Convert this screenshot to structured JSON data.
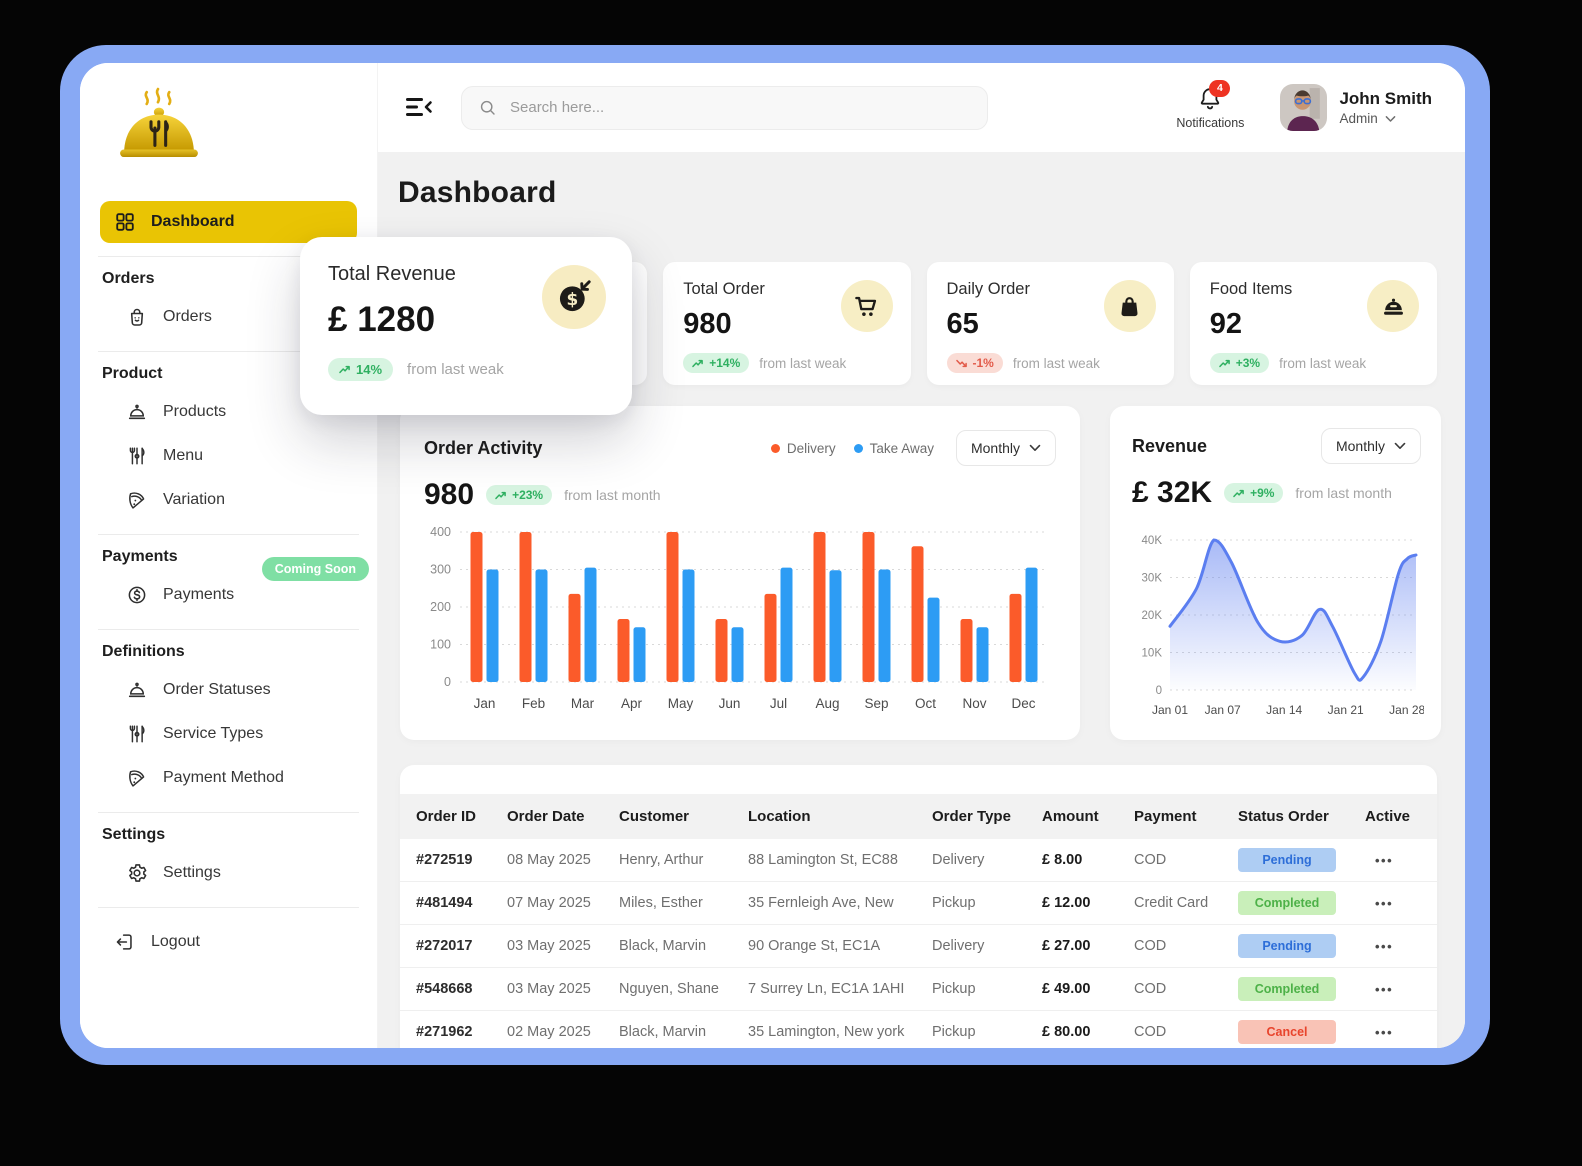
{
  "page": {
    "title": "Dashboard"
  },
  "topbar": {
    "search_placeholder": "Search here...",
    "notifications_label": "Notifications",
    "notifications_count": "4",
    "user_name": "John Smith",
    "user_role": "Admin"
  },
  "sidebar": {
    "sections": [
      {
        "items": [
          {
            "label": "Dashboard",
            "icon": "dashboard",
            "active": true
          }
        ]
      },
      {
        "header": "Orders",
        "items": [
          {
            "label": "Orders",
            "icon": "bag"
          }
        ]
      },
      {
        "header": "Product",
        "items": [
          {
            "label": "Products",
            "icon": "cloche"
          },
          {
            "label": "Menu",
            "icon": "cutlery"
          },
          {
            "label": "Variation",
            "icon": "pizza"
          }
        ]
      },
      {
        "header": "Payments",
        "badge": "Coming Soon",
        "items": [
          {
            "label": "Payments",
            "icon": "dollar"
          }
        ]
      },
      {
        "header": "Definitions",
        "items": [
          {
            "label": "Order Statuses",
            "icon": "cloche"
          },
          {
            "label": "Service Types",
            "icon": "cutlery"
          },
          {
            "label": "Payment Method",
            "icon": "pizza"
          }
        ]
      },
      {
        "header": "Settings",
        "items": [
          {
            "label": "Settings",
            "icon": "gear"
          }
        ]
      },
      {
        "items": [
          {
            "label": "Logout",
            "icon": "logout"
          }
        ]
      }
    ]
  },
  "stats": {
    "floating": {
      "title": "Total Revenue",
      "value": "£ 1280",
      "badge": "14%",
      "badge_dir": "up",
      "note": "from last weak",
      "icon": "money"
    },
    "cards": [
      {
        "title": "Total Order",
        "value": "980",
        "badge": "+14%",
        "badge_dir": "up",
        "note": "from last weak",
        "icon": "cart"
      },
      {
        "title": "Daily Order",
        "value": "65",
        "badge": "-1%",
        "badge_dir": "down",
        "note": "from last weak",
        "icon": "basket"
      },
      {
        "title": "Food Items",
        "value": "92",
        "badge": "+3%",
        "badge_dir": "up",
        "note": "from last weak",
        "icon": "cloche-solid"
      }
    ]
  },
  "order_activity": {
    "title": "Order Activity",
    "value": "980",
    "badge": "+23%",
    "note": "from last month",
    "filter": "Monthly"
  },
  "revenue": {
    "title": "Revenue",
    "value": "£ 32K",
    "badge": "+9%",
    "note": "from last month",
    "filter": "Monthly"
  },
  "chart_data": [
    {
      "id": "order-activity",
      "type": "bar",
      "title": "Order Activity",
      "categories": [
        "Jan",
        "Feb",
        "Mar",
        "Apr",
        "May",
        "Jun",
        "Jul",
        "Aug",
        "Sep",
        "Oct",
        "Nov",
        "Dec"
      ],
      "series": [
        {
          "name": "Delivery",
          "color": "#FB5B2A",
          "values": [
            400,
            400,
            235,
            168,
            400,
            168,
            235,
            400,
            400,
            362,
            168,
            235
          ]
        },
        {
          "name": "Take Away",
          "color": "#2D9CF4",
          "values": [
            300,
            300,
            305,
            146,
            300,
            146,
            305,
            298,
            300,
            225,
            146,
            305
          ]
        }
      ],
      "ylim": [
        0,
        400
      ],
      "yticks": [
        0,
        100,
        200,
        300,
        400
      ],
      "grid": "dotted-horizontal",
      "legend_position": "top-right",
      "xlabel": "",
      "ylabel": ""
    },
    {
      "id": "revenue",
      "type": "area",
      "title": "Revenue (£, January)",
      "x_days": [
        1,
        4,
        6,
        8,
        11,
        13.5,
        16,
        18,
        19.5,
        22,
        23,
        25,
        27,
        28,
        29
      ],
      "values_k": [
        17,
        27,
        40,
        34,
        18,
        13,
        14.5,
        21.5,
        17,
        4.5,
        3.5,
        13,
        31,
        35,
        36
      ],
      "xticks": [
        {
          "day": 1,
          "label": "Jan 01"
        },
        {
          "day": 7,
          "label": "Jan 07"
        },
        {
          "day": 14,
          "label": "Jan 14"
        },
        {
          "day": 21,
          "label": "Jan 21"
        },
        {
          "day": 28,
          "label": "Jan 28"
        }
      ],
      "yticks": [
        {
          "v": 0,
          "label": "0"
        },
        {
          "v": 10,
          "label": "10K"
        },
        {
          "v": 20,
          "label": "20K"
        },
        {
          "v": 30,
          "label": "30K"
        },
        {
          "v": 40,
          "label": "40K"
        }
      ],
      "ylim_k": [
        0,
        40
      ],
      "line_color": "#5B7EF0",
      "fill_from": "rgba(106,136,240,0.58)",
      "fill_to": "rgba(106,136,240,0.02)",
      "grid": "dotted-horizontal"
    }
  ],
  "table": {
    "headers": [
      "Order ID",
      "Order Date",
      "Customer",
      "Location",
      "Order Type",
      "Amount",
      "Payment",
      "Status Order",
      "Active"
    ],
    "actions_glyph": "•••",
    "rows": [
      {
        "id": "#272519",
        "date": "08 May 2025",
        "customer": "Henry, Arthur",
        "location": "88 Lamington St,  EC88",
        "type": "Delivery",
        "amount": "£ 8.00",
        "payment": "COD",
        "status": "Pending",
        "status_kind": "pending"
      },
      {
        "id": "#481494",
        "date": "07 May 2025",
        "customer": "Miles, Esther",
        "location": "35 Fernleigh Ave, New",
        "type": "Pickup",
        "amount": "£ 12.00",
        "payment": "Credit Card",
        "status": "Completed",
        "status_kind": "completed"
      },
      {
        "id": "#272017",
        "date": "03 May 2025",
        "customer": "Black, Marvin",
        "location": "90 Orange St, EC1A",
        "type": "Delivery",
        "amount": "£ 27.00",
        "payment": "COD",
        "status": "Pending",
        "status_kind": "pending"
      },
      {
        "id": "#548668",
        "date": "03 May 2025",
        "customer": "Nguyen, Shane",
        "location": "7 Surrey Ln, EC1A 1AHI",
        "type": "Pickup",
        "amount": "£ 49.00",
        "payment": "COD",
        "status": "Completed",
        "status_kind": "completed"
      },
      {
        "id": "#271962",
        "date": "02 May 2025",
        "customer": "Black, Marvin",
        "location": "35 Lamington, New york",
        "type": "Pickup",
        "amount": "£ 80.00",
        "payment": "COD",
        "status": "Cancel",
        "status_kind": "cancel"
      }
    ]
  },
  "colors": {
    "frame_blue": "#88A9F4",
    "active_yellow": "#E9C404",
    "icon_circle_cream": "#F7EEC5",
    "content_bg": "#F1F1F1",
    "badge_green_bg": "#D7F4E1",
    "badge_green_text": "#2FB061",
    "badge_red_bg": "#FADCD5",
    "badge_red_text": "#E25A49",
    "status_pending_bg": "#AECDF3",
    "status_pending_text": "#2D6ED8",
    "status_completed_bg": "#C9EFBA",
    "status_completed_text": "#4DB148",
    "status_cancel_bg": "#F9C3B6",
    "status_cancel_text": "#E8442C",
    "delivery_orange": "#FB5B2A",
    "takeaway_blue": "#2D9CF4",
    "revenue_line": "#5B7EF0",
    "coming_soon_green": "#7FDFA4",
    "notification_red": "#EE3322"
  }
}
